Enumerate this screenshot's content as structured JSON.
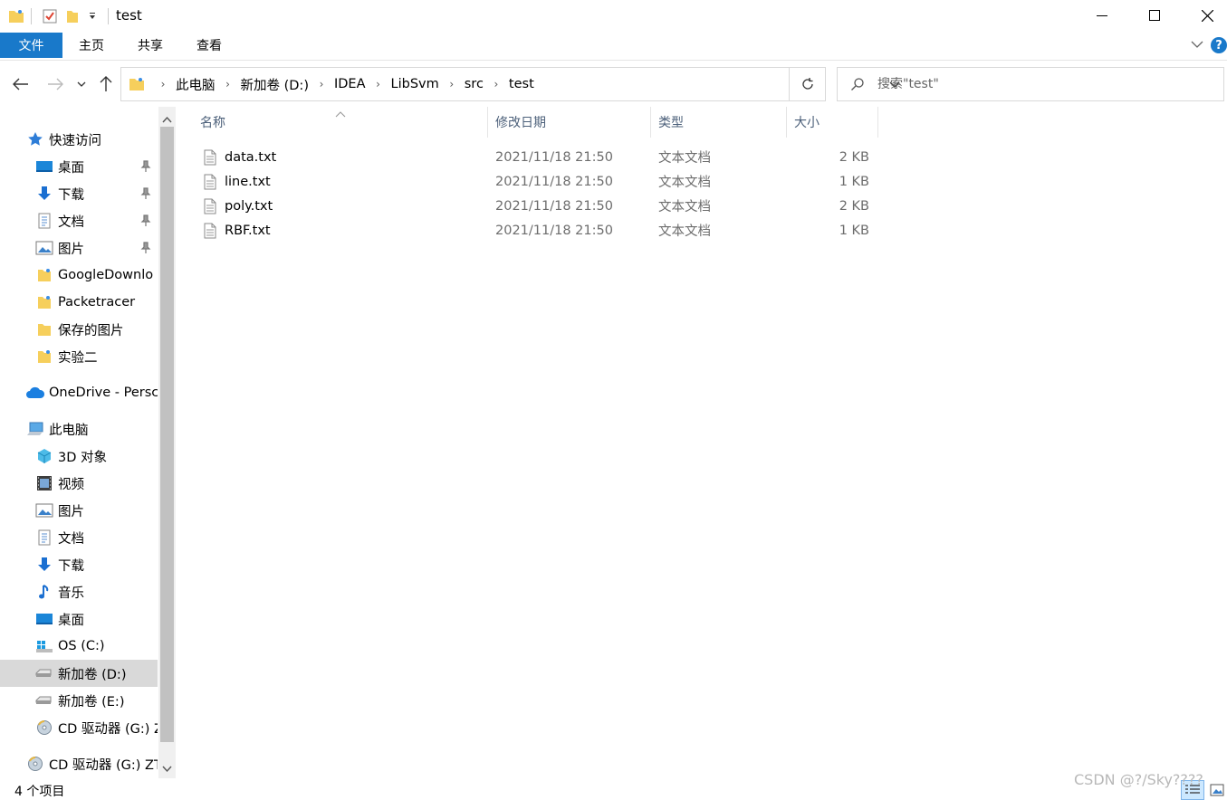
{
  "window": {
    "title": "test"
  },
  "ribbon": {
    "tabs": [
      "文件",
      "主页",
      "共享",
      "查看"
    ]
  },
  "address": {
    "crumbs": [
      "此电脑",
      "新加卷 (D:)",
      "IDEA",
      "LibSvm",
      "src",
      "test"
    ]
  },
  "search": {
    "placeholder": "搜索\"test\""
  },
  "nav": {
    "quick_access": "快速访问",
    "quick_items": [
      "桌面",
      "下载",
      "文档",
      "图片",
      "GoogleDownlo",
      "Packetracer",
      "保存的图片",
      "实验二"
    ],
    "onedrive": "OneDrive - Persc",
    "this_pc": "此电脑",
    "pc_items": [
      "3D 对象",
      "视频",
      "图片",
      "文档",
      "下载",
      "音乐",
      "桌面",
      "OS (C:)",
      "新加卷 (D:)",
      "新加卷 (E:)",
      "CD 驱动器 (G:) Z"
    ],
    "cd_drive": "CD 驱动器 (G:) ZT"
  },
  "columns": {
    "name": "名称",
    "modified": "修改日期",
    "type": "类型",
    "size": "大小"
  },
  "files": [
    {
      "name": "data.txt",
      "modified": "2021/11/18 21:50",
      "type": "文本文档",
      "size": "2 KB"
    },
    {
      "name": "line.txt",
      "modified": "2021/11/18 21:50",
      "type": "文本文档",
      "size": "1 KB"
    },
    {
      "name": "poly.txt",
      "modified": "2021/11/18 21:50",
      "type": "文本文档",
      "size": "2 KB"
    },
    {
      "name": "RBF.txt",
      "modified": "2021/11/18 21:50",
      "type": "文本文档",
      "size": "1 KB"
    }
  ],
  "status": {
    "item_count": "4 个项目"
  },
  "watermark": "CSDN @?/Sky????",
  "colors": {
    "accent": "#1979ca",
    "selected": "#d9d9d9",
    "header_text": "#4c607a"
  }
}
